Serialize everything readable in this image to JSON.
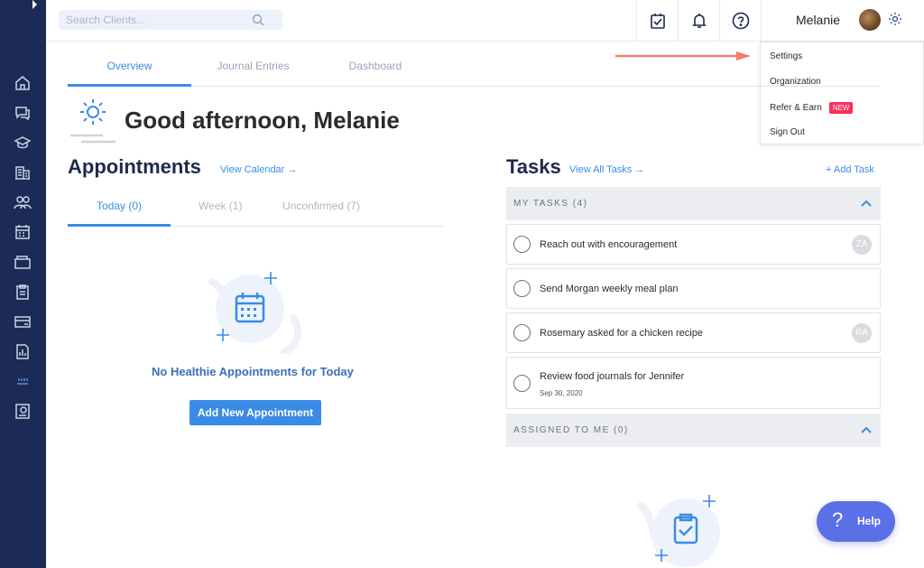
{
  "search": {
    "placeholder": "Search Clients..."
  },
  "user": {
    "name": "Melanie"
  },
  "dropdown": {
    "items": [
      "Settings",
      "Organization",
      "Refer & Earn",
      "Sign Out"
    ],
    "badge": "NEW"
  },
  "top_tabs": [
    "Overview",
    "Journal Entries",
    "Dashboard"
  ],
  "greeting": "Good afternoon, Melanie",
  "appointments": {
    "title": "Appointments",
    "link": "View Calendar →",
    "tabs": [
      "Today (0)",
      "Week (1)",
      "Unconfirmed (7)"
    ],
    "empty_title": "No Healthie Appointments for Today",
    "button": "Add New Appointment"
  },
  "tasks": {
    "title": "Tasks",
    "link": "View All Tasks →",
    "add": "+ Add Task",
    "my_tasks_header": "MY TASKS (4)",
    "assigned_header": "ASSIGNED TO ME (0)",
    "items": [
      {
        "text": "Reach out with encouragement",
        "avatar": "ZA",
        "date": ""
      },
      {
        "text": "Send Morgan weekly meal plan",
        "avatar": "",
        "date": ""
      },
      {
        "text": "Rosemary asked for a chicken recipe",
        "avatar": "RA",
        "date": ""
      },
      {
        "text": "Review food journals for Jennifer",
        "avatar": "",
        "date": "Sep 30, 2020"
      }
    ]
  },
  "help": {
    "label": "Help",
    "icon": "?"
  },
  "colors": {
    "sidebar": "#1c2b55",
    "accent": "#3a8be6",
    "badge": "#ff2d5a",
    "arrow": "#f47a6e",
    "help": "#5a70e6"
  }
}
